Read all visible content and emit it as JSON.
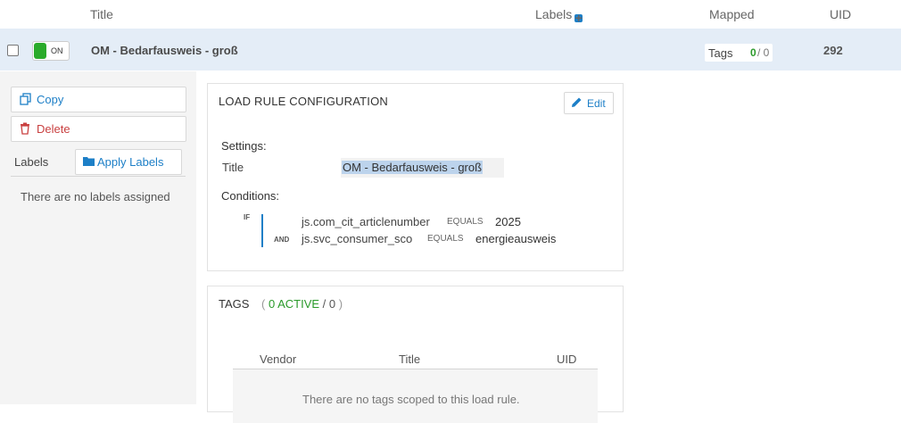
{
  "header": {
    "title_col": "Title",
    "labels_col": "Labels",
    "mapped_col": "Mapped",
    "uid_col": "UID"
  },
  "row": {
    "toggle_label": "ON",
    "title": "OM - Bedarfausweis - groß",
    "tags_label": "Tags",
    "tags_active": "0",
    "tags_total": "/ 0",
    "uid": "292"
  },
  "sidebar": {
    "copy_label": "Copy",
    "delete_label": "Delete",
    "labels_heading": "Labels",
    "apply_labels": "Apply Labels",
    "no_labels": "There are no labels assigned"
  },
  "load_rule": {
    "heading": "LOAD RULE CONFIGURATION",
    "edit_label": "Edit",
    "settings_label": "Settings:",
    "title_label": "Title",
    "title_value": "OM - Bedarfausweis - groß",
    "conditions_label": "Conditions:",
    "if_label": "IF",
    "and_label": "AND",
    "conditions": [
      {
        "variable": "js.com_cit_articlenumber",
        "operator": "EQUALS",
        "value": "2025"
      },
      {
        "variable": "js.svc_consumer_sco",
        "operator": "EQUALS",
        "value": "energieausweis"
      }
    ]
  },
  "tags_section": {
    "heading": "TAGS",
    "open": "(",
    "active": "0 ACTIVE",
    "slash": "/",
    "total": "0",
    "close": ")",
    "columns": [
      "Vendor",
      "Title",
      "UID"
    ],
    "empty_message": "There are no tags scoped to this load rule."
  },
  "colors": {
    "accent": "#1d7fc7",
    "on_green": "#2aab2a",
    "delete_red": "#c94040",
    "row_highlight": "#e4edf7"
  }
}
